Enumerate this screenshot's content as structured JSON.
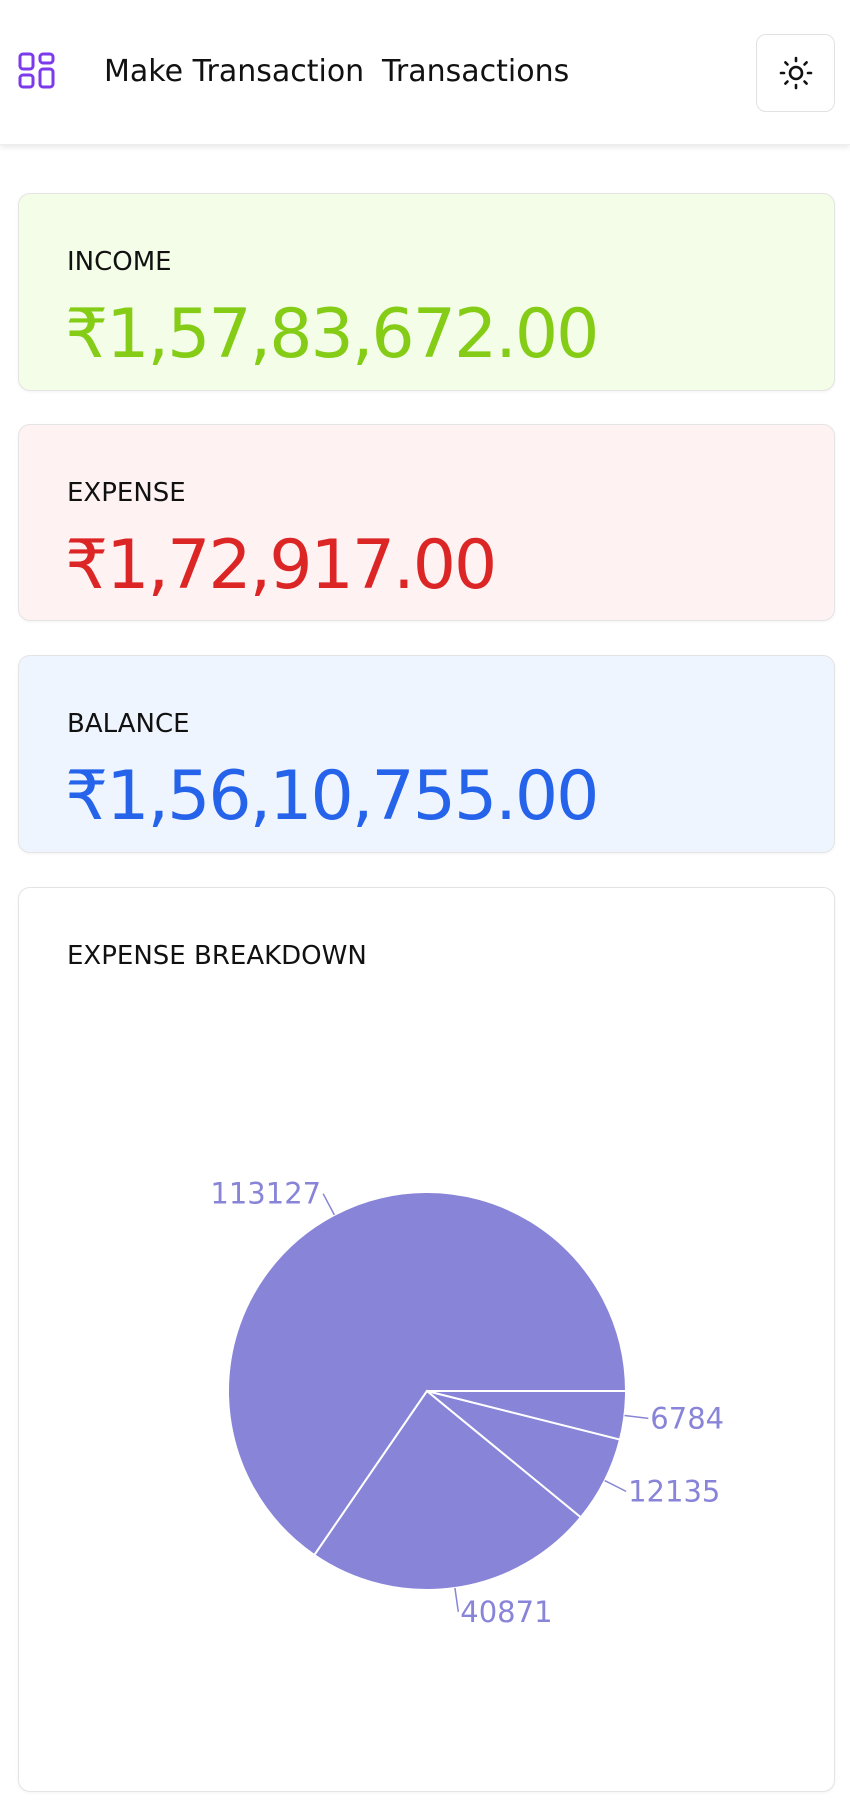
{
  "nav": {
    "logo_icon": "dashboard-grid-icon",
    "links": [
      "Make Transaction",
      "Transactions"
    ],
    "theme_toggle_icon": "sun-icon",
    "accent_color": "#7c3aed"
  },
  "cards": {
    "income": {
      "label": "INCOME",
      "value": "₹1,57,83,672.00",
      "color": "#84cc16",
      "bg": "#f4fde7"
    },
    "expense": {
      "label": "EXPENSE",
      "value": "₹1,72,917.00",
      "color": "#dc2626",
      "bg": "#fef2f2"
    },
    "balance": {
      "label": "BALANCE",
      "value": "₹1,56,10,755.00",
      "color": "#2563eb",
      "bg": "#eff5ff"
    }
  },
  "chart": {
    "title": "EXPENSE BREAKDOWN"
  },
  "chart_data": {
    "type": "pie",
    "title": "EXPENSE BREAKDOWN",
    "values": [
      113127,
      40871,
      12135,
      6784
    ],
    "labels": [
      "113127",
      "40871",
      "12135",
      "6784"
    ],
    "color": "#8884d8"
  }
}
